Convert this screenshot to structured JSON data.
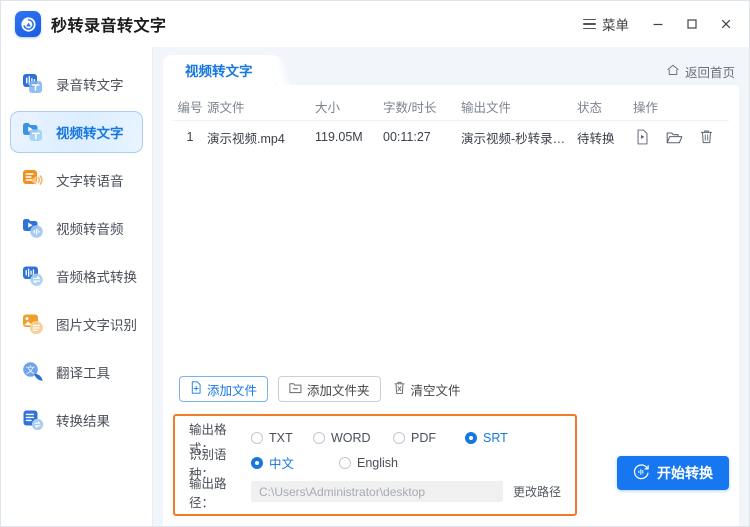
{
  "window": {
    "title": "秒转录音转文字",
    "logo_icon": "app-logo-icon",
    "menu_label": "菜单",
    "menu_icon": "hamburger-icon",
    "minimize_icon": "minimize-icon",
    "maximize_icon": "maximize-icon",
    "close_icon": "close-icon"
  },
  "sidebar": {
    "items": [
      {
        "label": "录音转文字",
        "icon": "audio-to-text-icon",
        "active": false
      },
      {
        "label": "视频转文字",
        "icon": "video-to-text-icon",
        "active": true
      },
      {
        "label": "文字转语音",
        "icon": "text-to-speech-icon",
        "active": false
      },
      {
        "label": "视频转音频",
        "icon": "video-to-audio-icon",
        "active": false
      },
      {
        "label": "音频格式转换",
        "icon": "audio-format-icon",
        "active": false
      },
      {
        "label": "图片文字识别",
        "icon": "image-ocr-icon",
        "active": false
      },
      {
        "label": "翻译工具",
        "icon": "translate-icon",
        "active": false
      },
      {
        "label": "转换结果",
        "icon": "results-icon",
        "active": false
      }
    ]
  },
  "main": {
    "tab_label": "视频转文字",
    "home_link_label": "返回首页",
    "home_icon": "home-icon"
  },
  "table": {
    "headers": {
      "no": "编号",
      "source": "源文件",
      "size": "大小",
      "duration": "字数/时长",
      "output": "输出文件",
      "status": "状态",
      "actions": "操作"
    },
    "rows": [
      {
        "no": "1",
        "source": "演示视频.mp4",
        "size": "119.05M",
        "duration": "00:11:27",
        "output": "演示视频-秒转录音转文...",
        "status": "待转换",
        "action_icons": [
          "preview-file-icon",
          "open-folder-icon",
          "delete-icon"
        ]
      }
    ]
  },
  "actions": {
    "add_file": "添加文件",
    "add_file_icon": "add-file-icon",
    "add_folder": "添加文件夹",
    "add_folder_icon": "add-folder-icon",
    "clear_files": "清空文件",
    "clear_files_icon": "clear-files-icon"
  },
  "settings": {
    "output_format_label": "输出格式：",
    "format_options": [
      {
        "label": "TXT",
        "selected": false
      },
      {
        "label": "WORD",
        "selected": false
      },
      {
        "label": "PDF",
        "selected": false
      },
      {
        "label": "SRT",
        "selected": true
      }
    ],
    "language_label": "识别语种：",
    "language_options": [
      {
        "label": "中文",
        "selected": true
      },
      {
        "label": "English",
        "selected": false
      }
    ],
    "output_path_label": "输出路径：",
    "output_path_value": "C:\\Users\\Administrator\\desktop",
    "change_path_label": "更改路径",
    "highlight_color": "#f07c28"
  },
  "start": {
    "label": "开始转换",
    "icon": "convert-icon",
    "color": "#1677f0"
  },
  "colors": {
    "accent": "#1677e0",
    "canvas": "#f2f5fa",
    "panel": "#ffffff",
    "muted_text": "#7d838f"
  }
}
